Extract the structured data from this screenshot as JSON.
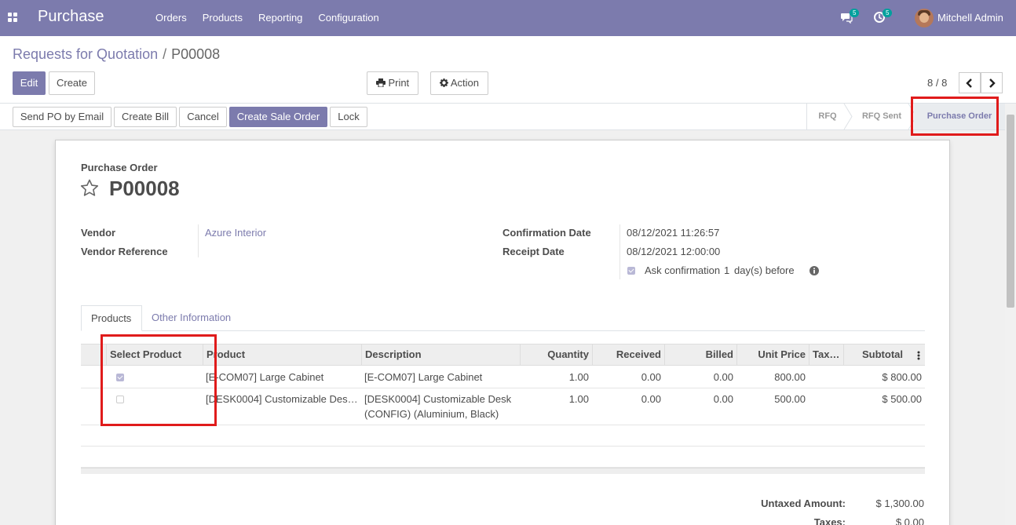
{
  "navbar": {
    "brand": "Purchase",
    "menu": [
      "Orders",
      "Products",
      "Reporting",
      "Configuration"
    ],
    "messages_count": "5",
    "activities_count": "5",
    "user_name": "Mitchell Admin"
  },
  "breadcrumb": {
    "parent": "Requests for Quotation",
    "separator": "/",
    "current": "P00008"
  },
  "buttons": {
    "edit": "Edit",
    "create": "Create",
    "print": "Print",
    "action": "Action"
  },
  "pager": {
    "text": "8 / 8"
  },
  "statusbar": {
    "buttons": [
      "Send PO by Email",
      "Create Bill",
      "Cancel",
      "Create Sale Order",
      "Lock"
    ],
    "stages": [
      "RFQ",
      "RFQ Sent",
      "Purchase Order"
    ],
    "active_stage": "Purchase Order"
  },
  "form": {
    "doc_type": "Purchase Order",
    "name": "P00008",
    "vendor_label": "Vendor",
    "vendor_value": "Azure Interior",
    "vendor_ref_label": "Vendor Reference",
    "confirmation_label": "Confirmation Date",
    "confirmation_value": "08/12/2021 11:26:57",
    "receipt_label": "Receipt Date",
    "receipt_value": "08/12/2021 12:00:00",
    "ask_confirmation_label": "Ask confirmation",
    "ask_confirmation_days": "1",
    "ask_confirmation_suffix": "day(s) before",
    "ask_confirmation_checked": true
  },
  "tabs": [
    "Products",
    "Other Information"
  ],
  "table": {
    "columns": [
      "Select Product",
      "Product",
      "Description",
      "Quantity",
      "Received",
      "Billed",
      "Unit Price",
      "Tax…",
      "Subtotal"
    ],
    "rows": [
      {
        "selected": true,
        "product": "[E-COM07] Large Cabinet",
        "description": "[E-COM07] Large Cabinet",
        "quantity": "1.00",
        "received": "0.00",
        "billed": "0.00",
        "unit_price": "800.00",
        "taxes": "",
        "subtotal": "$ 800.00"
      },
      {
        "selected": false,
        "product": "[DESK0004] Customizable Des…",
        "description": "[DESK0004] Customizable Desk (CONFIG) (Aluminium, Black)",
        "quantity": "1.00",
        "received": "0.00",
        "billed": "0.00",
        "unit_price": "500.00",
        "taxes": "",
        "subtotal": "$ 500.00"
      }
    ]
  },
  "totals": {
    "untaxed_label": "Untaxed Amount:",
    "untaxed_value": "$ 1,300.00",
    "taxes_label": "Taxes:",
    "taxes_value": "$ 0.00"
  },
  "colors": {
    "brand": "#7c7bad",
    "highlight": "#e01b1b"
  }
}
